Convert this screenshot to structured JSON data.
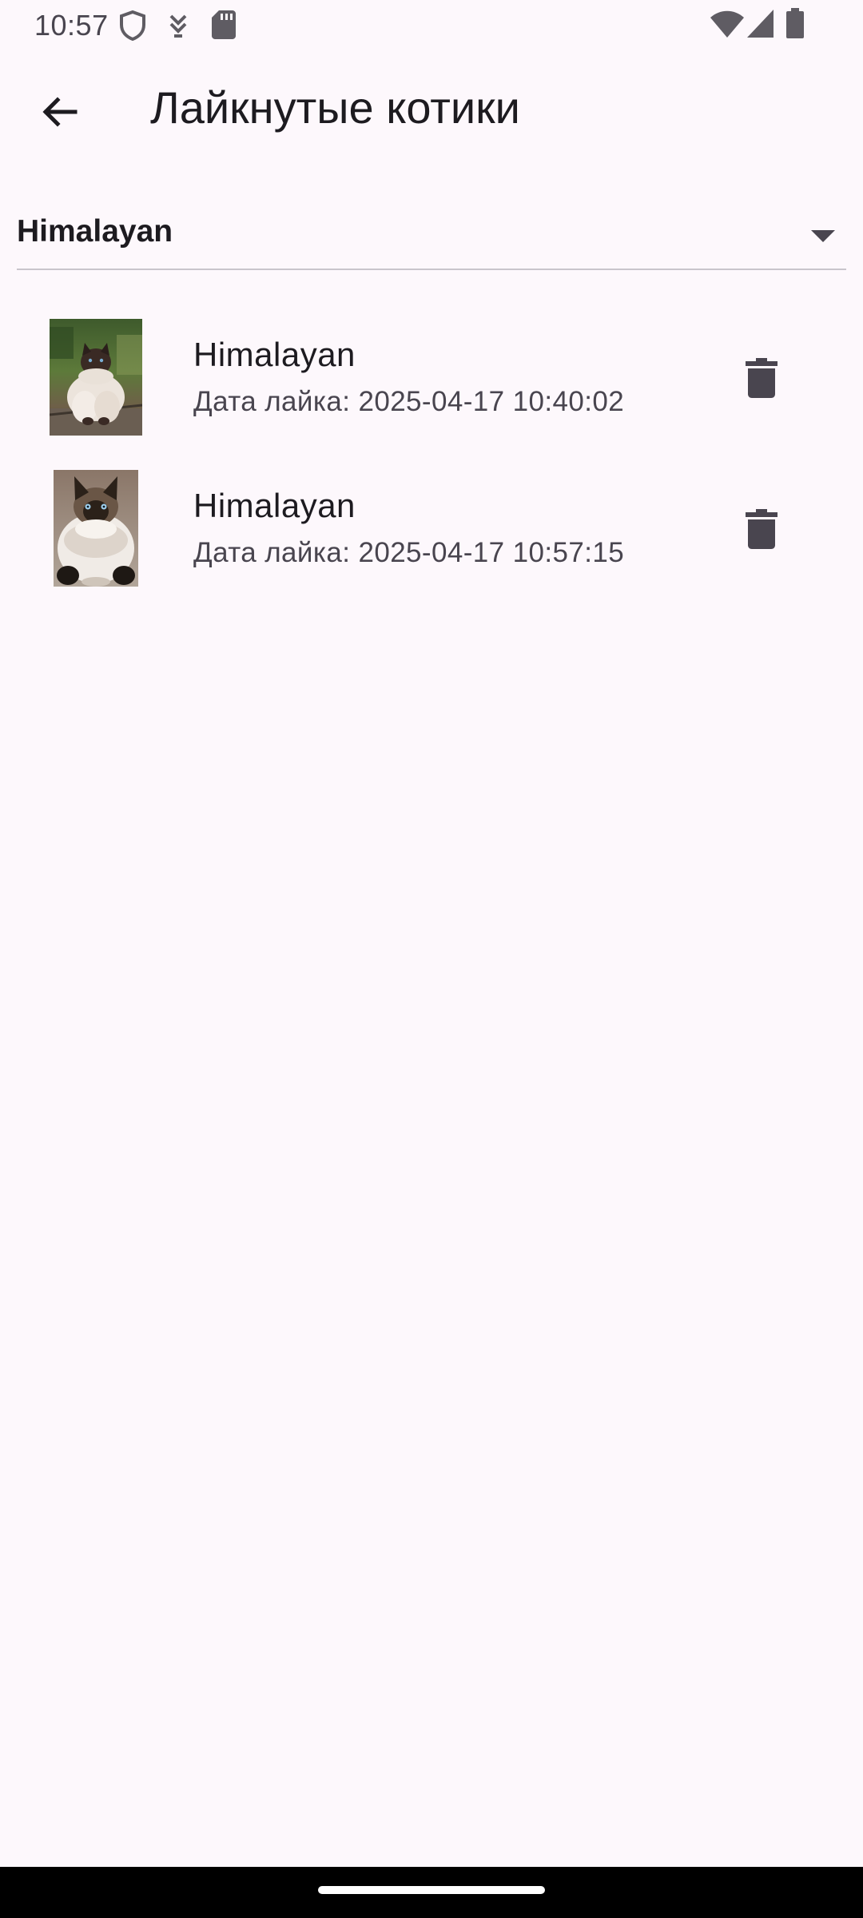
{
  "status_bar": {
    "time": "10:57",
    "icons": [
      "shield-icon",
      "download-icon",
      "sd-card-icon",
      "wifi-icon",
      "signal-icon",
      "battery-icon"
    ]
  },
  "app_bar": {
    "back_icon": "arrow-back-icon",
    "title": "Лайкнутые котики"
  },
  "breed_filter": {
    "selected": "Himalayan",
    "arrow_icon": "dropdown-arrow-icon"
  },
  "liked_cats": [
    {
      "breed": "Himalayan",
      "liked_label": "Дата лайка: 2025-04-17 10:40:02",
      "delete_icon": "delete-icon"
    },
    {
      "breed": "Himalayan",
      "liked_label": "Дата лайка: 2025-04-17 10:57:15",
      "delete_icon": "delete-icon"
    }
  ],
  "colors": {
    "background": "#fdf8fc",
    "on_surface": "#1d1b20",
    "on_surface_variant": "#49454f",
    "divider": "#c9c5cc",
    "nav_bar": "#000000"
  }
}
